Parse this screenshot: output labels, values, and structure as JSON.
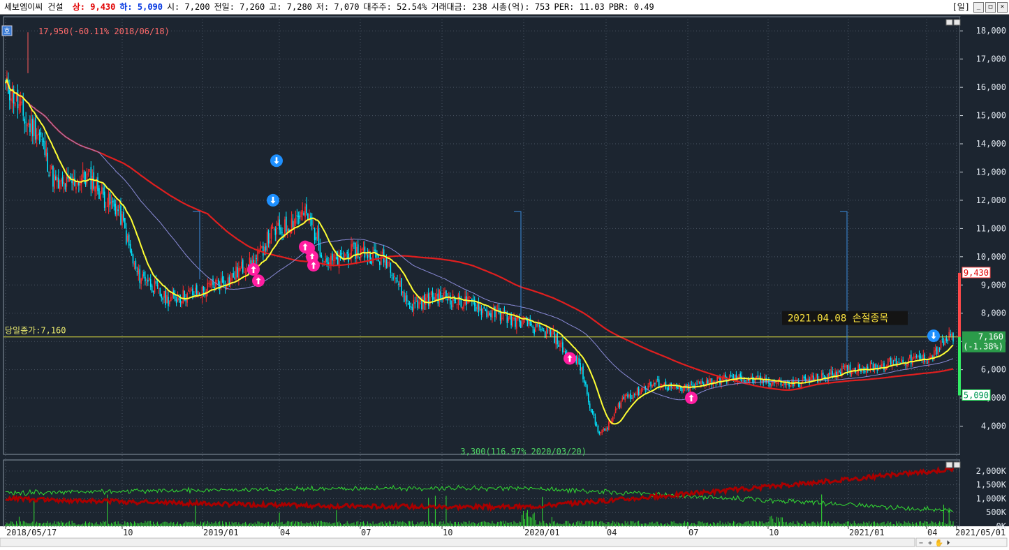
{
  "header": {
    "name": "세보엠이씨 건설",
    "items": [
      {
        "label": "상:",
        "value": "9,430",
        "kind": "up"
      },
      {
        "label": "하:",
        "value": "5,090",
        "kind": "dn"
      },
      {
        "label": "시:",
        "value": "7,200",
        "kind": "plain"
      },
      {
        "label": "전일:",
        "value": "7,260",
        "kind": "plain"
      },
      {
        "label": "고:",
        "value": "7,280",
        "kind": "plain"
      },
      {
        "label": "저:",
        "value": "7,070",
        "kind": "plain"
      },
      {
        "label": "대주주:",
        "value": "52.54%",
        "kind": "plain"
      },
      {
        "label": "거래대금:",
        "value": "238",
        "kind": "plain"
      },
      {
        "label": "시총(억):",
        "value": "753",
        "kind": "plain"
      },
      {
        "label": "PER:",
        "value": "11.03",
        "kind": "plain"
      },
      {
        "label": "PBR:",
        "value": "0.49",
        "kind": "plain"
      }
    ],
    "period": "[일]"
  },
  "side_button": "호",
  "colors": {
    "background": "#1c2530",
    "grid": "#4a5563",
    "up": "#ff2a2a",
    "down": "#00e5ff",
    "ma5": "#ffff33",
    "ma_long": "#e01f1f",
    "ma_mid": "#8b8bd8",
    "close_line": "#e8e840",
    "volume_up": "#33dd33",
    "volume_amount": "#aa0000",
    "signal_buy": "#ff1ea0",
    "signal_sell": "#1e90ff"
  },
  "chart_data": [
    {
      "type": "candlestick",
      "x_ticks": [
        "2018/05/17",
        "10",
        "2019/01",
        "04",
        "07",
        "10",
        "2020/01",
        "04",
        "07",
        "10",
        "2021/01",
        "04",
        "2021/05/01"
      ],
      "y_ticks": [
        "18,000",
        "17,000",
        "16,000",
        "15,000",
        "14,000",
        "13,000",
        "12,000",
        "11,000",
        "10,000",
        "9,000",
        "8,000",
        "7,000",
        "6,000",
        "5,000",
        "4,000"
      ],
      "ylim": [
        3000,
        18500
      ],
      "series": [
        {
          "dates": [
            "2018/05",
            "2018/06",
            "2018/07",
            "2018/08",
            "2018/09",
            "2018/10",
            "2018/11",
            "2018/12",
            "2019/01",
            "2019/02",
            "2019/03",
            "2019/04",
            "2019/05",
            "2019/06",
            "2019/07",
            "2019/08",
            "2019/09",
            "2019/10",
            "2019/11",
            "2019/12",
            "2020/01",
            "2020/02",
            "2020/03",
            "2020/04",
            "2020/05",
            "2020/06",
            "2020/07",
            "2020/08",
            "2020/09",
            "2020/10",
            "2020/11",
            "2020/12",
            "2021/01",
            "2021/02",
            "2021/03",
            "2021/04"
          ],
          "close": [
            16000,
            14600,
            12500,
            12800,
            11800,
            9300,
            8500,
            8700,
            9100,
            9700,
            10900,
            11500,
            9800,
            10200,
            9900,
            8300,
            8600,
            8400,
            8000,
            7700,
            7300,
            6400,
            3800,
            5100,
            5500,
            5300,
            5600,
            5700,
            5600,
            5500,
            5700,
            6000,
            6100,
            6300,
            6400,
            7160
          ]
        }
      ],
      "markers": [
        {
          "text": "17,950(-60.11% 2018/06/18)",
          "kind": "high"
        },
        {
          "text": "3,300(116.97% 2020/03/20)",
          "kind": "low"
        }
      ],
      "close_label": "당일종가:7,160",
      "annotation": "2021.04.08 손절종목",
      "price_tags": [
        {
          "text": "9,430",
          "kind": "upper"
        },
        {
          "text": "7,160",
          "kind": "current"
        },
        {
          "text": "(-1.38%)",
          "kind": "current_pct"
        },
        {
          "text": "5,090",
          "kind": "lower"
        }
      ]
    },
    {
      "type": "bar",
      "y_ticks": [
        "2,000K",
        "1,500K",
        "1,000K",
        "500K",
        "0K"
      ],
      "ylim": [
        0,
        2400
      ]
    }
  ]
}
